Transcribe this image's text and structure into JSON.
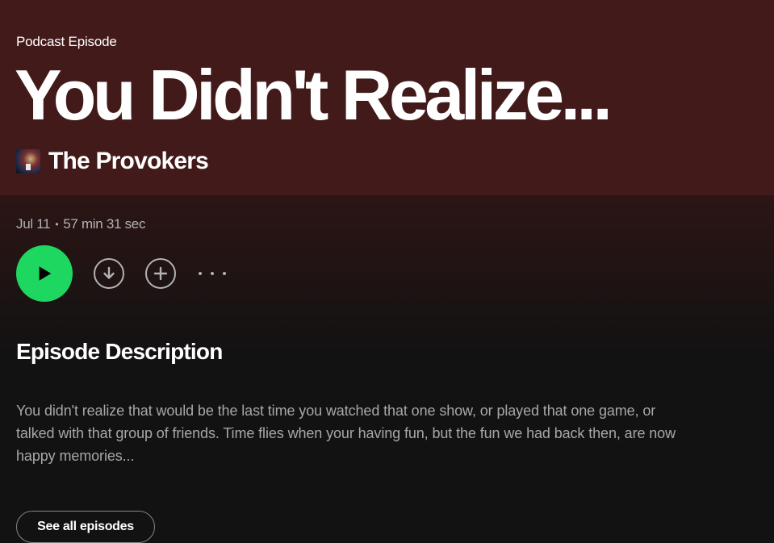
{
  "header": {
    "type_label": "Podcast Episode",
    "title": "You Didn't Realize...",
    "show_name": "The Provokers"
  },
  "meta": {
    "date": "Jul 11",
    "separator": "•",
    "duration": "57 min 31 sec"
  },
  "controls": {
    "play_icon": "play-icon",
    "download_icon": "download-circle-icon",
    "add_icon": "add-circle-icon",
    "more_icon": "more-horizontal-icon"
  },
  "description": {
    "heading": "Episode Description",
    "text": "You didn't realize that would be the last time you watched that one show, or played that one game, or talked with that group of friends. Time flies when your having fun, but the fun we had back then, are now happy memories..."
  },
  "footer": {
    "see_all_label": "See all episodes"
  },
  "colors": {
    "hero_background": "#431a1a",
    "page_background": "#121212",
    "play_button": "#1ed760",
    "muted_text": "#b3b3b3"
  }
}
